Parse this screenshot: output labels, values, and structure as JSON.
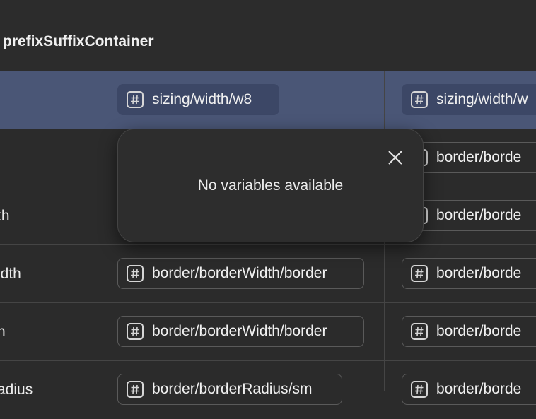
{
  "header": {
    "title": "prefixSuffixContainer"
  },
  "rows": [
    {
      "label": "",
      "col1": "sizing/width/w8",
      "col2": "sizing/width/w"
    },
    {
      "label": "",
      "col1": "",
      "col2": "border/borde"
    },
    {
      "label": "th",
      "col1": "",
      "col2": "border/borde"
    },
    {
      "label": "idth",
      "col1": "border/borderWidth/border",
      "col2": "border/borde"
    },
    {
      "label": "h",
      "col1": "border/borderWidth/border",
      "col2": "border/borde"
    },
    {
      "label": "adius",
      "col1": "border/borderRadius/sm",
      "col2": "border/borde"
    }
  ],
  "popup": {
    "message": "No variables available"
  },
  "icons": {
    "variable": "hash-icon",
    "close": "close-icon"
  },
  "colors": {
    "selected_row": "#4a5676",
    "filled_chip": "#3c4766",
    "background": "#2b2b2b"
  }
}
